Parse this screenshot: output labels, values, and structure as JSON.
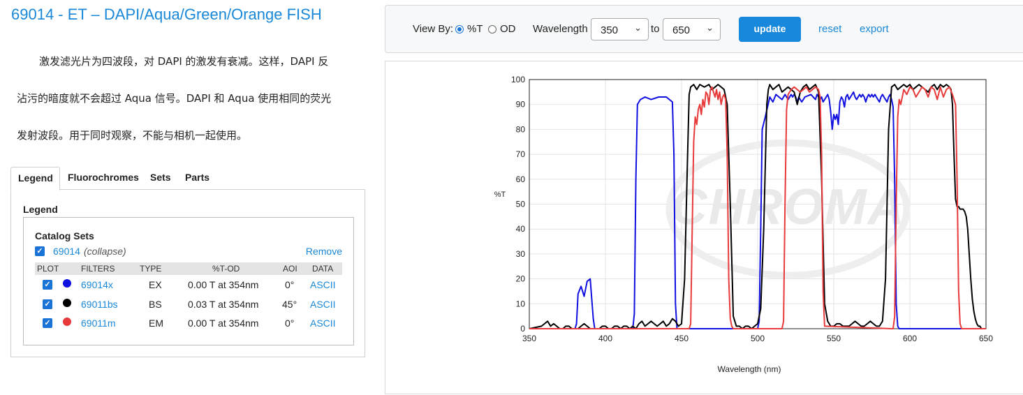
{
  "page": {
    "title": "69014 - ET – DAPI/Aqua/Green/Orange FISH",
    "description": [
      "激发滤光片为四波段，对 DAPI 的激发有衰减。这样，DAPI 反",
      "沾污的暗度就不会超过 Aqua 信号。DAPI 和 Aqua 使用相同的荧光",
      "发射波段。用于同时观察，不能与相机一起使用。"
    ]
  },
  "tabs": [
    "Legend",
    "Fluorochromes",
    "Sets",
    "Parts"
  ],
  "legend": {
    "heading": "Legend",
    "catalog_title": "Catalog Sets",
    "set_code": "69014",
    "collapse_label": "(collapse)",
    "remove_label": "Remove",
    "columns": [
      "PLOT",
      "FILTERS",
      "TYPE",
      "%T-OD",
      "AOI",
      "DATA"
    ],
    "rows": [
      {
        "filter": "69014x",
        "type": "EX",
        "tod": "0.00 T at 354nm",
        "aoi": "0°",
        "data": "ASCII",
        "color": "#1010e0"
      },
      {
        "filter": "69011bs",
        "type": "BS",
        "tod": "0.03 T at 354nm",
        "aoi": "45°",
        "data": "ASCII",
        "color": "#000000"
      },
      {
        "filter": "69011m",
        "type": "EM",
        "tod": "0.00 T at 354nm",
        "aoi": "0°",
        "data": "ASCII",
        "color": "#e83a3a"
      }
    ]
  },
  "toolbar": {
    "view_by_label": "View By:",
    "option_t": "%T",
    "option_od": "OD",
    "wavelength_label": "Wavelength",
    "from_value": "350",
    "to_label": "to",
    "to_value": "650",
    "update_label": "update",
    "reset_label": "reset",
    "export_label": "export"
  },
  "chart_data": {
    "type": "line",
    "xlabel": "Wavelength (nm)",
    "ylabel": "%T",
    "xlim": [
      350,
      650
    ],
    "ylim": [
      0,
      100
    ],
    "xticks": [
      350,
      400,
      450,
      500,
      550,
      600,
      650
    ],
    "yticks": [
      0,
      10,
      20,
      30,
      40,
      50,
      60,
      70,
      80,
      90,
      100
    ],
    "grid": true,
    "watermark": "CHROMA",
    "series": [
      {
        "name": "69014x",
        "color": "#1010e0",
        "x": [
          350,
          380,
          381,
          382,
          384,
          386,
          388,
          390,
          391,
          392,
          393,
          418,
          419,
          420,
          421,
          423,
          426,
          430,
          435,
          440,
          442,
          444,
          445,
          446,
          447,
          465,
          500,
          501,
          502,
          503,
          505,
          508,
          510,
          512,
          514,
          516,
          517,
          518,
          519,
          520,
          521,
          522,
          523,
          524,
          525,
          526,
          527,
          528,
          529,
          531,
          535,
          538,
          539,
          540,
          541,
          542,
          543,
          544,
          545,
          546,
          547,
          548,
          549,
          550,
          551,
          552,
          553,
          554,
          555,
          556,
          557,
          558,
          559,
          560,
          561,
          562,
          563,
          564,
          565,
          567,
          568,
          569,
          570,
          571,
          572,
          573,
          574,
          575,
          576,
          577,
          578,
          579,
          580,
          581,
          582,
          583,
          584,
          585,
          586,
          587,
          588,
          589,
          590,
          591,
          592,
          593,
          594,
          597,
          600,
          650
        ],
        "y": [
          0,
          0,
          2,
          14,
          17,
          13,
          19,
          20,
          12,
          4,
          0,
          0,
          6,
          60,
          90,
          92,
          93,
          92,
          93,
          93,
          92,
          91,
          70,
          10,
          0,
          0,
          0,
          3,
          40,
          80,
          85,
          93,
          91,
          94,
          93,
          92,
          93,
          94,
          93,
          92,
          93,
          94,
          93,
          94,
          93,
          91,
          93,
          92,
          91,
          93,
          94,
          92,
          94,
          93,
          92,
          93,
          91,
          92,
          93,
          94,
          92,
          87,
          80,
          86,
          84,
          86,
          82,
          91,
          93,
          92,
          89,
          93,
          94,
          92,
          93,
          94,
          95,
          93,
          92,
          94,
          93,
          94,
          93,
          91,
          93,
          94,
          93,
          94,
          93,
          94,
          93,
          92,
          91,
          93,
          94,
          93,
          92,
          91,
          93,
          94,
          92,
          89,
          60,
          10,
          1,
          0,
          0,
          0,
          0,
          0
        ]
      },
      {
        "name": "69011bs",
        "color": "#000000",
        "x": [
          350,
          358,
          360,
          362,
          364,
          366,
          368,
          370,
          372,
          374,
          376,
          378,
          380,
          382,
          384,
          386,
          388,
          390,
          392,
          394,
          396,
          398,
          400,
          402,
          404,
          406,
          408,
          410,
          412,
          414,
          416,
          418,
          420,
          422,
          424,
          426,
          428,
          430,
          432,
          434,
          436,
          438,
          440,
          442,
          444,
          446,
          448,
          450,
          452,
          454,
          455,
          456,
          458,
          460,
          462,
          465,
          468,
          470,
          472,
          474,
          476,
          478,
          480,
          482,
          484,
          486,
          488,
          490,
          492,
          494,
          496,
          498,
          500,
          502,
          504,
          506,
          507,
          508,
          509,
          510,
          512,
          514,
          516,
          518,
          520,
          522,
          524,
          526,
          528,
          530,
          532,
          534,
          536,
          538,
          540,
          542,
          544,
          546,
          548,
          550,
          552,
          554,
          556,
          558,
          560,
          562,
          564,
          566,
          568,
          570,
          572,
          574,
          576,
          578,
          580,
          582,
          584,
          586,
          588,
          590,
          592,
          594,
          596,
          598,
          600,
          602,
          604,
          606,
          608,
          610,
          612,
          614,
          616,
          618,
          620,
          622,
          624,
          626,
          627,
          628,
          629,
          630,
          631,
          632,
          633,
          634,
          635,
          636,
          637,
          638,
          639,
          640,
          641,
          642,
          643,
          644,
          645,
          646,
          647,
          648,
          650
        ],
        "y": [
          0,
          1,
          2,
          3,
          1,
          2,
          1,
          0,
          0,
          1,
          1,
          0,
          0,
          0,
          1,
          2,
          1,
          0,
          0,
          0,
          0,
          1,
          1,
          0,
          0,
          1,
          1,
          0,
          1,
          1,
          0,
          1,
          0,
          2,
          3,
          1,
          2,
          3,
          2,
          1,
          2,
          3,
          1,
          2,
          4,
          3,
          1,
          2,
          20,
          70,
          94,
          97,
          98,
          96,
          98,
          97,
          98,
          96,
          97,
          98,
          97,
          96,
          90,
          50,
          5,
          1,
          1,
          0,
          1,
          1,
          0,
          1,
          2,
          8,
          40,
          90,
          96,
          98,
          97,
          96,
          97,
          98,
          95,
          96,
          97,
          96,
          95,
          90,
          95,
          97,
          98,
          96,
          97,
          98,
          95,
          60,
          10,
          3,
          1,
          1,
          2,
          2,
          1,
          1,
          1,
          2,
          3,
          2,
          1,
          1,
          2,
          3,
          2,
          1,
          1,
          3,
          20,
          80,
          97,
          98,
          96,
          97,
          98,
          97,
          98,
          96,
          97,
          98,
          97,
          96,
          95,
          97,
          98,
          96,
          98,
          97,
          98,
          97,
          96,
          90,
          70,
          52,
          49,
          49,
          48,
          48,
          48,
          47,
          45,
          40,
          30,
          20,
          12,
          7,
          4,
          2,
          1,
          1,
          0,
          0,
          0
        ]
      },
      {
        "name": "69011m",
        "color": "#e83a3a",
        "x": [
          350,
          455,
          456,
          457,
          458,
          459,
          460,
          461,
          462,
          463,
          464,
          465,
          466,
          467,
          468,
          469,
          470,
          471,
          472,
          473,
          474,
          475,
          476,
          477,
          478,
          479,
          480,
          481,
          482,
          483,
          484,
          516,
          517,
          518,
          519,
          520,
          522,
          524,
          526,
          528,
          530,
          532,
          534,
          536,
          538,
          540,
          541,
          542,
          543,
          544,
          588,
          589,
          590,
          591,
          592,
          593,
          594,
          596,
          598,
          600,
          602,
          604,
          606,
          608,
          610,
          612,
          614,
          616,
          618,
          620,
          622,
          624,
          626,
          628,
          630,
          631,
          632,
          633,
          634,
          650
        ],
        "y": [
          0,
          0,
          2,
          40,
          75,
          85,
          82,
          88,
          90,
          86,
          92,
          89,
          95,
          94,
          90,
          96,
          97,
          95,
          93,
          96,
          92,
          95,
          90,
          93,
          94,
          92,
          70,
          20,
          4,
          1,
          0,
          0,
          3,
          50,
          88,
          94,
          96,
          97,
          96,
          95,
          96,
          97,
          95,
          96,
          97,
          96,
          93,
          70,
          15,
          1,
          0,
          0,
          5,
          50,
          85,
          92,
          90,
          96,
          94,
          97,
          96,
          93,
          95,
          97,
          96,
          93,
          97,
          96,
          92,
          97,
          93,
          96,
          97,
          94,
          90,
          60,
          15,
          2,
          0,
          0
        ]
      }
    ]
  }
}
